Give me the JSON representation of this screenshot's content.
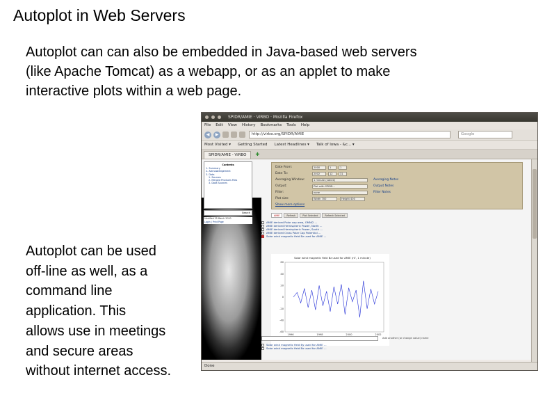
{
  "slide": {
    "title": "Autoplot in Web Servers",
    "intro_lines": [
      "Autoplot can can also be embedded in Java-based web servers",
      "(like Apache Tomcat) as a webapp, or as an applet to make",
      "interactive plots within a web page."
    ],
    "offline_lines": [
      "Autoplot can be used",
      "off-line as well, as a",
      "command line",
      "application.  This",
      "allows use in meetings",
      "and secure areas",
      "without internet access."
    ]
  },
  "browser": {
    "window_title": "SPIDR/AMIE · ViRBO · Mozilla Firefox",
    "menu": [
      "File",
      "Edit",
      "View",
      "History",
      "Bookmarks",
      "Tools",
      "Help"
    ],
    "url": "http://virbo.org/SPIDR/AMIE",
    "search_placeholder": "Google",
    "bookmarks": [
      "Most Visited ▾",
      "Getting Started",
      "Latest Headlines ▾",
      "Talk of Iowa - &c... ▾"
    ],
    "tab_label": "SPIDR/AMIE - ViRBO",
    "status": "Done"
  },
  "webpage": {
    "toc": {
      "heading": "Contents",
      "items": [
        "1. Summary",
        "2. Acknowledgement",
        "3. Data",
        "  1. Sources",
        "  2. Merged Products Files",
        "  3. Data Sources"
      ],
      "search_label": "Search",
      "modified": "Modified 25 March 2010",
      "links": "Login | Print Page"
    },
    "form": {
      "rows": [
        {
          "label": "Date From:",
          "values": [
            "2000",
            "1",
            "1"
          ]
        },
        {
          "label": "Date To:",
          "values": [
            "2002",
            "12",
            "31"
          ]
        },
        {
          "label": "Averaging Window:",
          "values": [
            "1 minute (native)"
          ]
        },
        {
          "label": "Output:",
          "values": [
            "Plot with SPIDR..."
          ]
        },
        {
          "label": "Filter:",
          "values": [
            "none"
          ]
        },
        {
          "label": "Plot size:",
          "values": [
            "Width 700",
            "Height 400"
          ]
        }
      ],
      "links": [
        "Averaging Notes",
        "Output Notes",
        "Filter Notes"
      ],
      "more_options": "Show more options"
    },
    "product_tabs": [
      "AMIE",
      "Refresh",
      "Plot Selected",
      "Refresh Selected"
    ],
    "products": [
      "AMIE derived Polar cap area, OMNI2 ...",
      "AMIE derived Hemispheric Power, North ...",
      "AMIE derived Hemispheric Power, South ...",
      "AMIE derived Cross Polar Cap Potential ...",
      "Solar wind magnetic field Bz used for AMIE ..."
    ],
    "more_products": [
      "Solar wind magnetic field By used for AMIE ...",
      "Solar wind magnetic field Bx used for AMIE ..."
    ],
    "plot_footer_note": "Add another (or change value) name"
  },
  "chart_data": {
    "type": "line",
    "title": "Solar wind magnetic field Bz used for AMIE (nT, 1 minute)",
    "x": [
      "1996",
      "1998",
      "2000",
      "2002"
    ],
    "y_ticks": [
      -60,
      -40,
      -20,
      0,
      20,
      40,
      60
    ],
    "ylim": [
      -60,
      60
    ],
    "series": [
      {
        "color": "#1f2bd6",
        "values": [
          0,
          8,
          -10,
          15,
          -18,
          12,
          -22,
          20,
          -15,
          10,
          -25,
          18,
          -12,
          22,
          -30,
          16,
          -8,
          12,
          -35,
          28,
          -20,
          14,
          -12,
          10
        ]
      }
    ]
  }
}
